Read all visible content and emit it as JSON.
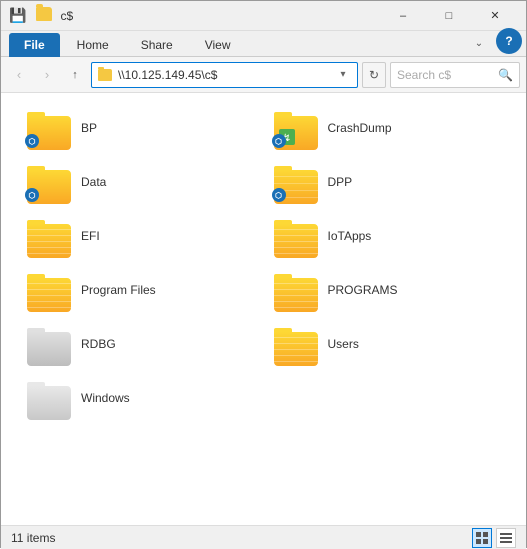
{
  "titleBar": {
    "title": "c$",
    "titleIconLabel": "folder-icon",
    "minButton": "–",
    "maxButton": "□",
    "closeButton": "✕"
  },
  "ribbonTabs": {
    "file": "File",
    "home": "Home",
    "share": "Share",
    "view": "View",
    "helpLabel": "?"
  },
  "navBar": {
    "backBtn": "‹",
    "forwardBtn": "›",
    "upBtn": "↑",
    "address": "\\\\10.125.149.45\\c$",
    "dropdownArrow": "▾",
    "refreshSymbol": "↻",
    "searchPlaceholder": "Search c$",
    "searchIcon": "🔍"
  },
  "folders": [
    {
      "id": "bp",
      "name": "BP",
      "type": "network"
    },
    {
      "id": "crashdump",
      "name": "CrashDump",
      "type": "crashdump"
    },
    {
      "id": "data",
      "name": "Data",
      "type": "network"
    },
    {
      "id": "dpp",
      "name": "DPP",
      "type": "striped-network"
    },
    {
      "id": "efi",
      "name": "EFI",
      "type": "striped"
    },
    {
      "id": "iotapps",
      "name": "IoTApps",
      "type": "striped"
    },
    {
      "id": "programfiles",
      "name": "Program Files",
      "type": "striped"
    },
    {
      "id": "programs",
      "name": "PROGRAMS",
      "type": "striped"
    },
    {
      "id": "rdbg",
      "name": "RDBG",
      "type": "gray"
    },
    {
      "id": "users",
      "name": "Users",
      "type": "striped"
    },
    {
      "id": "windows",
      "name": "Windows",
      "type": "windows"
    }
  ],
  "statusBar": {
    "itemCount": "11 items",
    "viewGrid": "⊞",
    "viewList": "☰"
  }
}
